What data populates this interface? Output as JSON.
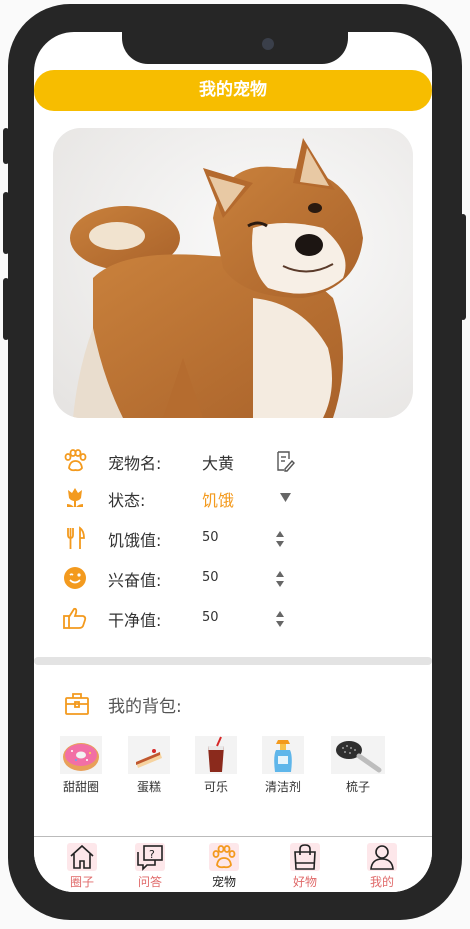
{
  "header": {
    "title": "我的宠物"
  },
  "pet": {
    "name_label": "宠物名:",
    "name_value": "大黄",
    "status_label": "状态:",
    "status_value": "饥饿",
    "hunger_label": "饥饿值:",
    "hunger_value": "50",
    "excite_label": "兴奋值:",
    "excite_value": "50",
    "clean_label": "干净值:",
    "clean_value": "50"
  },
  "bag": {
    "title": "我的背包:",
    "items": [
      {
        "label": "甜甜圈"
      },
      {
        "label": "蛋糕"
      },
      {
        "label": "可乐"
      },
      {
        "label": "清洁剂"
      },
      {
        "label": "梳子"
      }
    ]
  },
  "tabs": [
    {
      "label": "圈子",
      "icon": "home-icon"
    },
    {
      "label": "问答",
      "icon": "qa-icon"
    },
    {
      "label": "宠物",
      "icon": "paw-icon"
    },
    {
      "label": "好物",
      "icon": "shopping-bag-icon"
    },
    {
      "label": "我的",
      "icon": "user-icon"
    }
  ],
  "colors": {
    "accent": "#f7bd00",
    "icon_orange": "#f39a1e",
    "status_orange": "#f39a1e",
    "tab_text": "#e06a6a"
  }
}
